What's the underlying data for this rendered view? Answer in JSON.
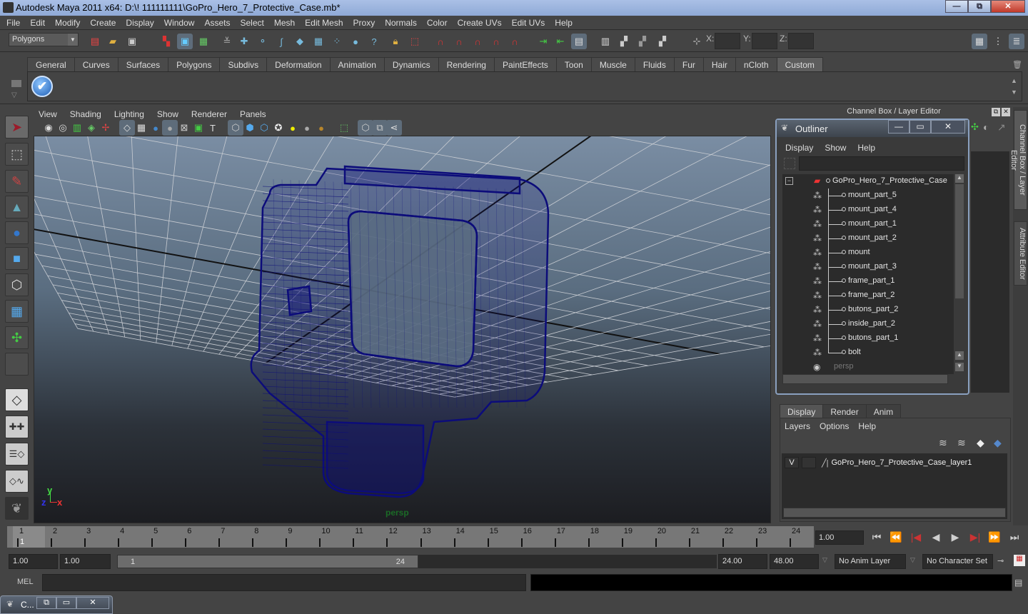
{
  "window": {
    "title": "Autodesk Maya 2011 x64: D:\\! 111111111\\GoPro_Hero_7_Protective_Case.mb*",
    "minimize": "—",
    "restore": "⧉",
    "close": "✕"
  },
  "menubar": [
    "File",
    "Edit",
    "Modify",
    "Create",
    "Display",
    "Window",
    "Assets",
    "Select",
    "Mesh",
    "Edit Mesh",
    "Proxy",
    "Normals",
    "Color",
    "Create UVs",
    "Edit UVs",
    "Help"
  ],
  "statusline": {
    "mode": "Polygons",
    "x_label": "X:",
    "y_label": "Y:",
    "z_label": "Z:",
    "x_value": "",
    "y_value": "",
    "z_value": ""
  },
  "shelf": {
    "tabs": [
      "General",
      "Curves",
      "Surfaces",
      "Polygons",
      "Subdivs",
      "Deformation",
      "Animation",
      "Dynamics",
      "Rendering",
      "PaintEffects",
      "Toon",
      "Muscle",
      "Fluids",
      "Fur",
      "Hair",
      "nCloth",
      "Custom"
    ],
    "active_tab": "Custom",
    "check_glyph": "✔"
  },
  "viewport": {
    "menu": [
      "View",
      "Shading",
      "Lighting",
      "Show",
      "Renderer",
      "Panels"
    ],
    "camera_label": "persp",
    "axis": {
      "x": "x",
      "y": "y",
      "z": "z"
    },
    "wire_color": "#0c0c7a"
  },
  "channel_box": {
    "title": "Channel Box / Layer Editor",
    "side_tabs": [
      "Channel Box / Layer Editor",
      "Attribute Editor"
    ]
  },
  "outliner": {
    "title": "Outliner",
    "menu": [
      "Display",
      "Show",
      "Help"
    ],
    "filter": "",
    "root": "GoPro_Hero_7_Protective_Case",
    "children": [
      "mount_part_5",
      "mount_part_4",
      "mount_part_1",
      "mount_part_2",
      "mount",
      "mount_part_3",
      "frame_part_1",
      "frame_part_2",
      "butons_part_2",
      "inside_part_2",
      "butons_part_1",
      "bolt"
    ],
    "camera": "persp"
  },
  "layer_editor": {
    "tabs": [
      "Display",
      "Render",
      "Anim"
    ],
    "active_tab": "Display",
    "menu": [
      "Layers",
      "Options",
      "Help"
    ],
    "layers": [
      {
        "visible": "V",
        "name": "GoPro_Hero_7_Protective_Case_layer1"
      }
    ]
  },
  "timeline": {
    "ticks": [
      "1",
      "2",
      "3",
      "4",
      "5",
      "6",
      "7",
      "8",
      "9",
      "10",
      "11",
      "12",
      "13",
      "14",
      "15",
      "16",
      "17",
      "18",
      "19",
      "20",
      "21",
      "22",
      "23",
      "24"
    ],
    "current_frame_marker": "1",
    "current_frame": "1.00",
    "playback": [
      "⏮",
      "⏪",
      "|◀",
      "◀",
      "▶",
      "▶|",
      "⏩",
      "⏭"
    ]
  },
  "range": {
    "start": "1.00",
    "playback_start": "1.00",
    "slider_start": "1",
    "slider_end": "24",
    "playback_end": "24.00",
    "end": "48.00",
    "anim_layer": "No Anim Layer",
    "character_set": "No Character Set"
  },
  "command_line": {
    "label": "MEL",
    "input": "",
    "output": ""
  },
  "minimized_window": {
    "title": "C..."
  }
}
